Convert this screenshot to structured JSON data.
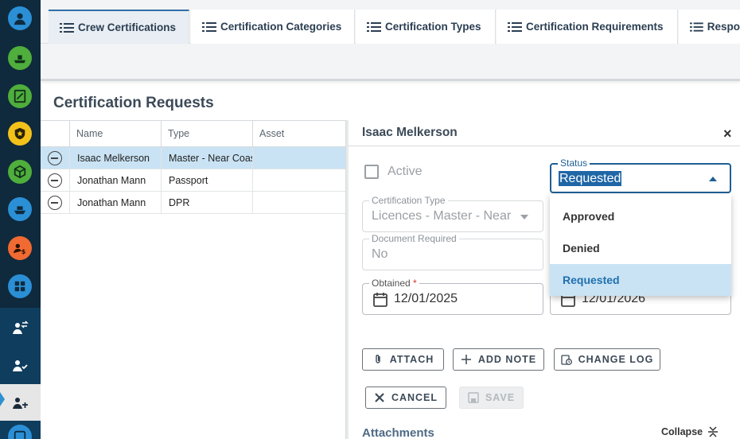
{
  "tabs": [
    {
      "label": "Crew Certifications",
      "active": true
    },
    {
      "label": "Certification Categories",
      "active": false
    },
    {
      "label": "Certification Types",
      "active": false
    },
    {
      "label": "Certification Requirements",
      "active": false
    },
    {
      "label": "Respo",
      "active": false
    }
  ],
  "section_title": "Certification Requests",
  "grid": {
    "columns": [
      "Name",
      "Type",
      "Asset"
    ],
    "rows": [
      {
        "name": "Isaac Melkerson",
        "type": "Master - Near Coastal",
        "asset": "",
        "selected": true
      },
      {
        "name": "Jonathan Mann",
        "type": "Passport",
        "asset": "",
        "selected": false
      },
      {
        "name": "Jonathan Mann",
        "type": "DPR",
        "asset": "",
        "selected": false
      }
    ]
  },
  "detail": {
    "title": "Isaac Melkerson",
    "close_label": "×",
    "active_label": "Active",
    "status": {
      "label": "Status",
      "value": "Requested",
      "options": [
        {
          "label": "Approved",
          "selected": false
        },
        {
          "label": "Denied",
          "selected": false
        },
        {
          "label": "Requested",
          "selected": true
        }
      ]
    },
    "certification_type": {
      "label": "Certification Type",
      "value": "Licences - Master - Near"
    },
    "document_required": {
      "label": "Document Required",
      "value": "No"
    },
    "obtained": {
      "label": "Obtained",
      "required_mark": "*",
      "value": "12/01/2025"
    },
    "hidden_date_fragment": "12/01/2026",
    "buttons": {
      "attach": "ATTACH",
      "add_note": "ADD NOTE",
      "change_log": "CHANGE LOG",
      "cancel": "CANCEL",
      "save": "SAVE"
    },
    "attachments_title": "Attachments",
    "collapse_label": "Collapse"
  },
  "colors": {
    "rail": "#0f2a3c",
    "accent": "#1f5f93",
    "selection": "#c9e3f4"
  }
}
